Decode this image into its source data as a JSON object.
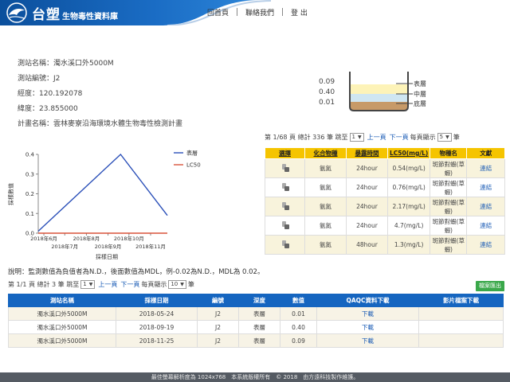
{
  "header": {
    "logo_main": "台塑",
    "logo_sub": "生物毒性資料庫",
    "nav": [
      "回首頁",
      "聯絡我們",
      "登 出"
    ]
  },
  "info": [
    {
      "label": "測站名稱：",
      "value": "濁水溪口外5000M"
    },
    {
      "label": "測站編號：",
      "value": "J2"
    },
    {
      "label": "經度：",
      "value": "120.192078"
    },
    {
      "label": "緯度：",
      "value": "23.855000"
    },
    {
      "label": "計畫名稱：",
      "value": "雲林麥寮沿海環境水體生物毒性檢測計畫"
    }
  ],
  "depth": {
    "values": [
      "0.09",
      "0.40",
      "0.01"
    ],
    "labels": [
      "表層",
      "中層",
      "底層"
    ]
  },
  "results_pager": {
    "prefix": "第 1/68 頁 總計 336 筆 跳至",
    "page": "1",
    "prev": "上一頁",
    "next": "下一頁",
    "per_label": "每頁顯示",
    "per": "5",
    "suffix": "筆"
  },
  "chart_data": {
    "type": "line",
    "x": [
      "2018-05-24",
      "2018-09-19",
      "2018-11-25"
    ],
    "series": [
      {
        "name": "表層",
        "color": "#2a4fb8",
        "values": [
          0.01,
          0.4,
          0.09
        ]
      },
      {
        "name": "LC50",
        "color": "#d9533a",
        "values": [
          0,
          0,
          0
        ]
      }
    ],
    "ylim": [
      0,
      0.4
    ],
    "yticks": [
      "0.4",
      "0.3",
      "0.2",
      "0.1",
      "0.0"
    ],
    "xticks_top": [
      "2018年6月",
      "2018年8月",
      "2018年10月"
    ],
    "xticks_bottom": [
      "2018年7月",
      "2018年9月",
      "2018年11月"
    ],
    "ylabel": "採樣數值",
    "xlabel": "採樣日期"
  },
  "results_table": {
    "headers": [
      "選擇",
      "化合物種",
      "暴露時間",
      "LC50(mg/L)",
      "物種名",
      "文獻"
    ],
    "rows": [
      {
        "compound": "氨氮",
        "time": "24hour",
        "lc50": "0.54(mg/L)",
        "species": "斑節對蝦(草蝦)",
        "ref": "連結"
      },
      {
        "compound": "氨氮",
        "time": "24hour",
        "lc50": "0.76(mg/L)",
        "species": "斑節對蝦(草蝦)",
        "ref": "連結"
      },
      {
        "compound": "氨氮",
        "time": "24hour",
        "lc50": "2.17(mg/L)",
        "species": "斑節對蝦(草蝦)",
        "ref": "連結"
      },
      {
        "compound": "氨氮",
        "time": "24hour",
        "lc50": "4.7(mg/L)",
        "species": "斑節對蝦(草蝦)",
        "ref": "連結"
      },
      {
        "compound": "氨氮",
        "time": "48hour",
        "lc50": "1.3(mg/L)",
        "species": "斑節對蝦(草蝦)",
        "ref": "連結"
      }
    ]
  },
  "note": "說明：監測數值為負值者為N.D.，後面數值為MDL，例-0.02為N.D.，MDL為 0.02。",
  "samples_pager": {
    "prefix": "第 1/1 頁 總計 3 筆 跳至",
    "page": "1",
    "prev": "上一頁",
    "next": "下一頁",
    "per_label": "每頁顯示",
    "per": "10",
    "suffix": "筆"
  },
  "export_button": "檔案匯出",
  "samples_table": {
    "headers": [
      "測站名稱",
      "採樣日期",
      "編號",
      "深度",
      "數值",
      "QAQC資料下載",
      "影片檔案下載"
    ],
    "rows": [
      {
        "station": "濁水溪口外5000M",
        "date": "2018-05-24",
        "id": "J2",
        "depth": "表層",
        "value": "0.01",
        "qaqc": "下載",
        "video": ""
      },
      {
        "station": "濁水溪口外5000M",
        "date": "2018-09-19",
        "id": "J2",
        "depth": "表層",
        "value": "0.40",
        "qaqc": "下載",
        "video": ""
      },
      {
        "station": "濁水溪口外5000M",
        "date": "2018-11-25",
        "id": "J2",
        "depth": "表層",
        "value": "0.09",
        "qaqc": "下載",
        "video": ""
      }
    ]
  },
  "footer": "最佳螢幕解析度為 1024x768　本系統版權所有　© 2018　由方遠科技製作維護。"
}
